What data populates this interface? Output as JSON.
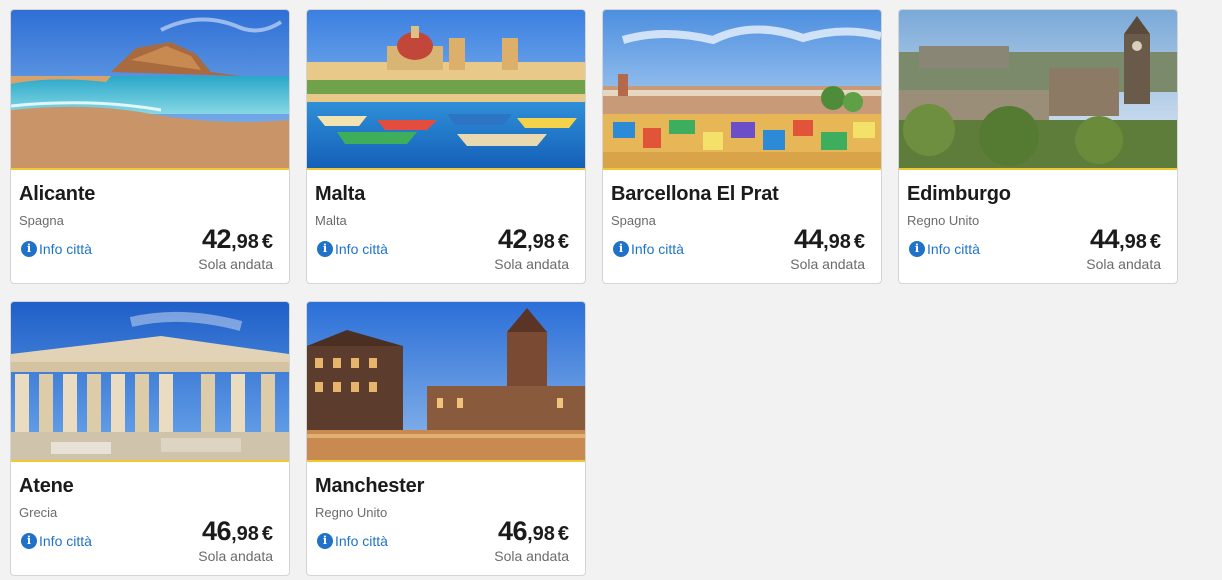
{
  "destinations": [
    {
      "city": "Alicante",
      "country": "Spagna",
      "info_label": "Info città",
      "price_int": "42",
      "price_dec": ",98",
      "currency": "€",
      "fare_label": "Sola andata",
      "image": "beach-cliff-photo"
    },
    {
      "city": "Malta",
      "country": "Malta",
      "info_label": "Info città",
      "price_int": "42",
      "price_dec": ",98",
      "currency": "€",
      "fare_label": "Sola andata",
      "image": "harbor-boats-photo"
    },
    {
      "city": "Barcellona El Prat",
      "country": "Spagna",
      "info_label": "Info città",
      "price_int": "44",
      "price_dec": ",98",
      "currency": "€",
      "fare_label": "Sola andata",
      "image": "park-guell-mosaic-photo"
    },
    {
      "city": "Edimburgo",
      "country": "Regno Unito",
      "info_label": "Info città",
      "price_int": "44",
      "price_dec": ",98",
      "currency": "€",
      "fare_label": "Sola andata",
      "image": "old-town-skyline-photo"
    },
    {
      "city": "Atene",
      "country": "Grecia",
      "info_label": "Info città",
      "price_int": "46",
      "price_dec": ",98",
      "currency": "€",
      "fare_label": "Sola andata",
      "image": "parthenon-photo"
    },
    {
      "city": "Manchester",
      "country": "Regno Unito",
      "info_label": "Info città",
      "price_int": "46",
      "price_dec": ",98",
      "currency": "€",
      "fare_label": "Sola andata",
      "image": "town-hall-dusk-photo"
    }
  ],
  "colors": {
    "accent": "#f1c933",
    "link": "#1f72c7",
    "text": "#1b1b1b",
    "muted": "#6b6b6b",
    "background": "#f2f2f2"
  }
}
